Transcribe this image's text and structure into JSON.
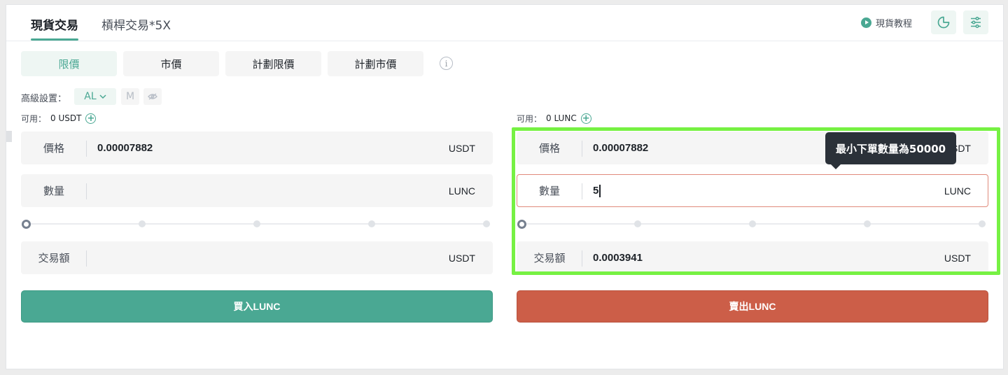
{
  "header": {
    "tabs": [
      {
        "label": "現貨交易",
        "active": true
      },
      {
        "label": "槓桿交易*5X",
        "active": false
      }
    ],
    "tutorial_label": "現貨教程",
    "icons": {
      "tutorial": "play-circle-icon",
      "chart": "pie-chart-icon",
      "settings": "sliders-icon"
    }
  },
  "order_types": [
    {
      "label": "限價",
      "active": true
    },
    {
      "label": "市價",
      "active": false
    },
    {
      "label": "計劃限價",
      "active": false
    },
    {
      "label": "計劃市價",
      "active": false
    }
  ],
  "info_icon_glyph": "i",
  "advanced": {
    "label": "高級設置：",
    "al_label": "AL",
    "m_label": "M"
  },
  "buy": {
    "available_label": "可用：",
    "available_value": "0 USDT",
    "price_label": "價格",
    "price_value": "0.00007882",
    "price_unit": "USDT",
    "amount_label": "數量",
    "amount_value": "",
    "amount_unit": "LUNC",
    "slider_percent": 0,
    "total_label": "交易額",
    "total_value": "",
    "total_unit": "USDT",
    "button_label": "買入LUNC"
  },
  "sell": {
    "available_label": "可用：",
    "available_value": "0 LUNC",
    "price_label": "價格",
    "price_value": "0.00007882",
    "price_unit": "USDT",
    "amount_label": "數量",
    "amount_value": "5",
    "amount_unit": "LUNC",
    "slider_percent": 0,
    "total_label": "交易額",
    "total_value": "0.0003941",
    "total_unit": "USDT",
    "button_label": "賣出LUNC"
  },
  "tooltip": "最小下單數量為50000",
  "colors": {
    "accent": "#4aa893",
    "sell": "#cc5e48",
    "highlight": "#76f143",
    "tooltip_bg": "#2b3139"
  }
}
